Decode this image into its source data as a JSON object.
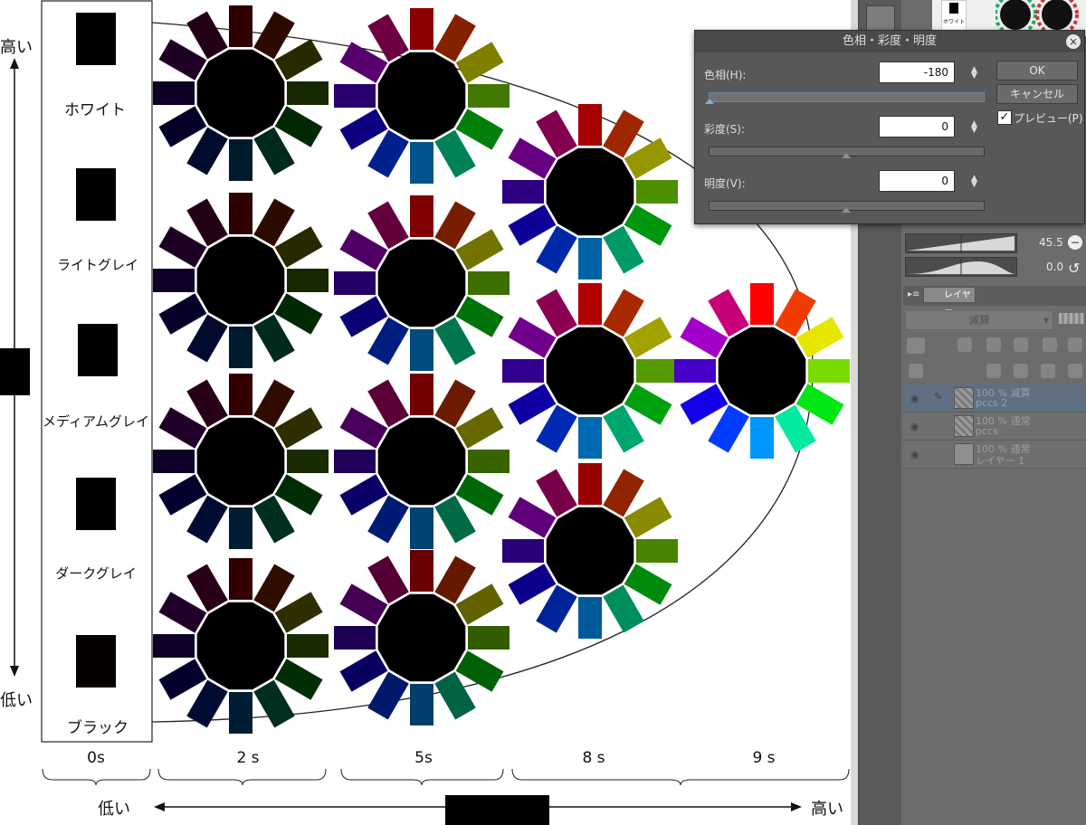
{
  "canvas": {
    "value_axis": {
      "top_label": "高い",
      "bottom_label": "低い"
    },
    "saturation_axis": {
      "left_label": "低い",
      "right_label": "高い"
    },
    "gray_scale": [
      {
        "label": "ホワイト"
      },
      {
        "label": "ライトグレイ"
      },
      {
        "label": "メディアムグレイ"
      },
      {
        "label": "ダークグレイ"
      },
      {
        "label": "ブラック"
      }
    ],
    "column_labels": [
      "0s",
      "2 s",
      "5s",
      "8 s",
      "9 s"
    ]
  },
  "dialog": {
    "title": "色相・彩度・明度",
    "hue": {
      "label": "色相(H):",
      "value": "-180"
    },
    "saturation": {
      "label": "彩度(S):",
      "value": "0"
    },
    "brightness": {
      "label": "明度(V):",
      "value": "0"
    },
    "ok_label": "OK",
    "cancel_label": "キャンセル",
    "preview_label": "プレビュー(P)",
    "preview_checked": true
  },
  "panel": {
    "thumbnail_label": "ホワイト",
    "brush_size": "45.5",
    "brush_angle": "0.0",
    "layer_tab_label": "レイヤー",
    "blend_mode": "減算",
    "layers": [
      {
        "line1": "100 % 減算",
        "line2": "pccs 2",
        "selected": true,
        "pattern": true
      },
      {
        "line1": "100 % 通常",
        "line2": "pccs",
        "selected": false,
        "pattern": true
      },
      {
        "line1": "100 % 通常",
        "line2": "レイヤー 1",
        "selected": false,
        "pattern": false
      }
    ]
  }
}
